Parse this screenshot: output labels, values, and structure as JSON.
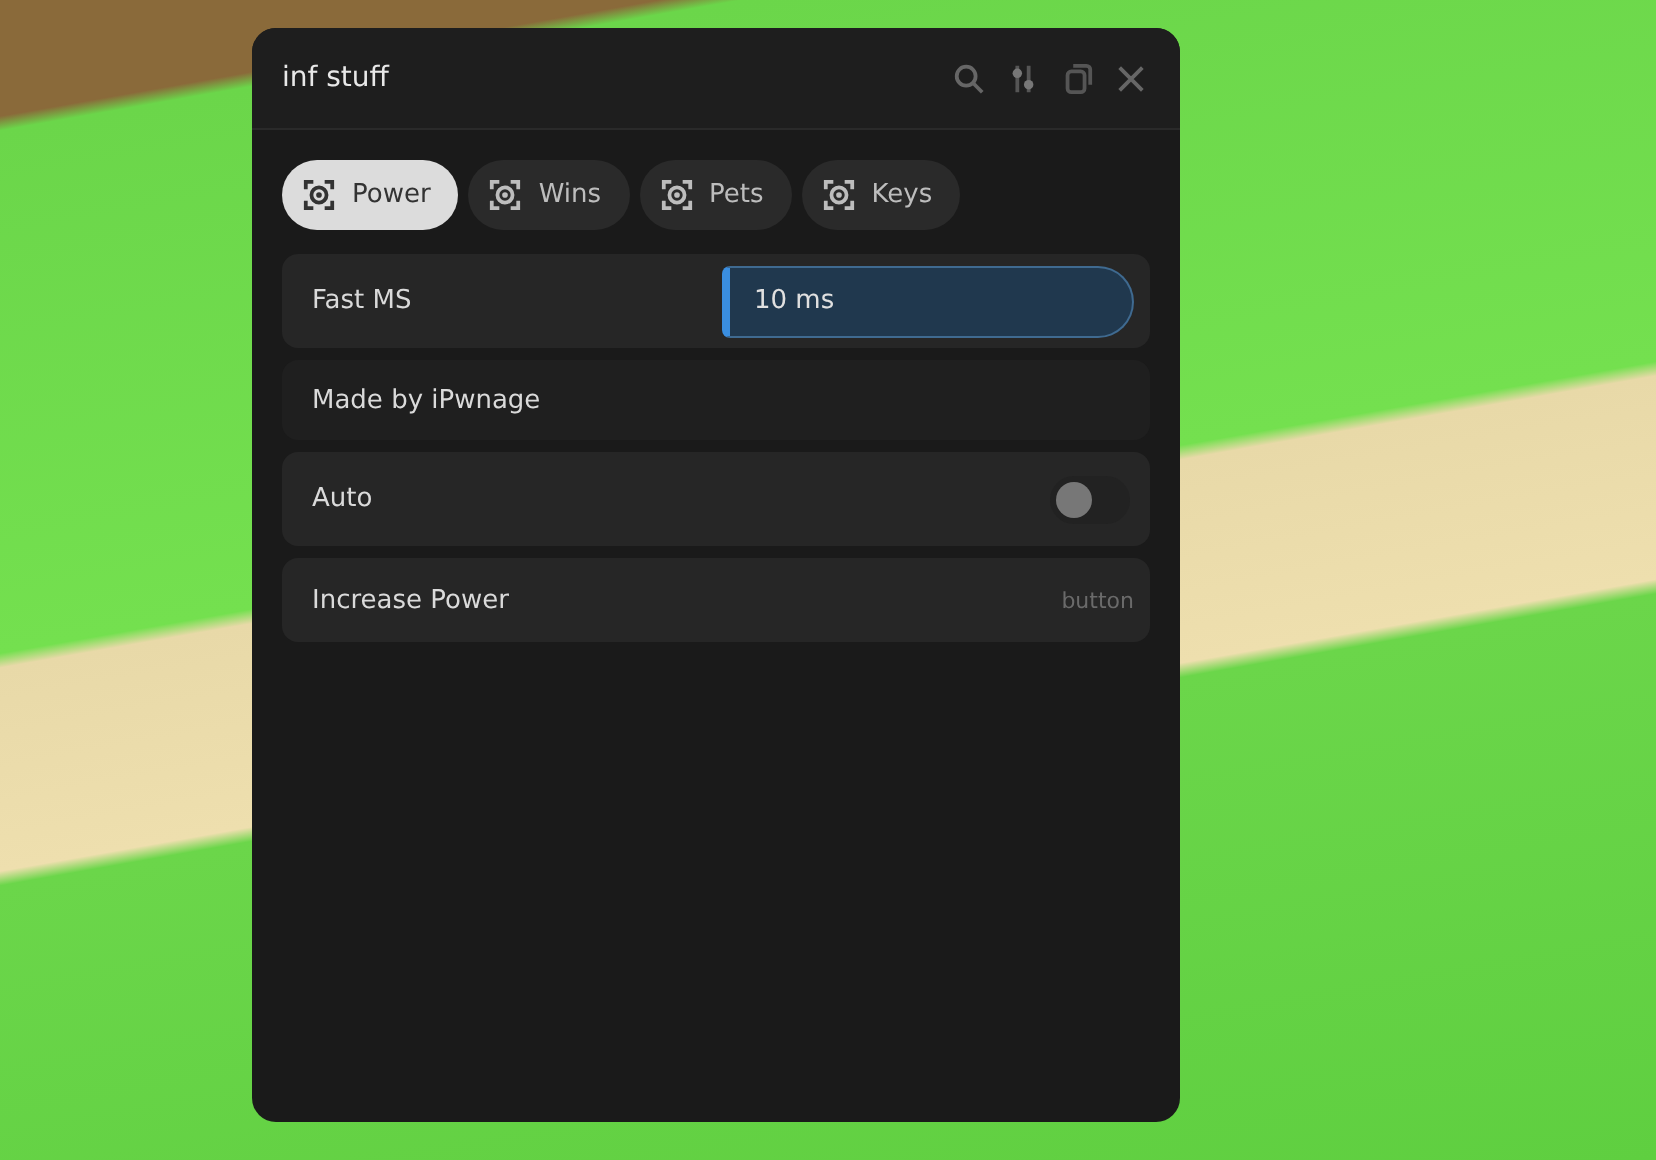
{
  "window": {
    "title": "inf stuff"
  },
  "tabs": [
    {
      "label": "Power",
      "selected": true
    },
    {
      "label": "Wins",
      "selected": false
    },
    {
      "label": "Pets",
      "selected": false
    },
    {
      "label": "Keys",
      "selected": false
    }
  ],
  "elements": [
    {
      "kind": "input",
      "label": "Fast MS",
      "value": "10 ms"
    },
    {
      "kind": "label",
      "label": "Made by iPwnage"
    },
    {
      "kind": "toggle",
      "label": "Auto",
      "on": false
    },
    {
      "kind": "button",
      "label": "Increase Power",
      "hint": "button"
    }
  ]
}
